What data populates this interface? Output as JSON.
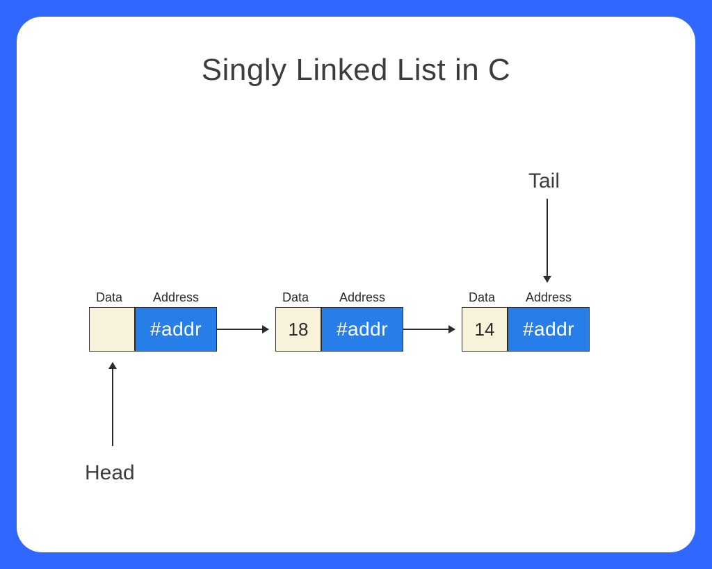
{
  "title": "Singly Linked List in C",
  "columns": {
    "data": "Data",
    "address": "Address"
  },
  "nodes": [
    {
      "data": "",
      "address": "#addr"
    },
    {
      "data": "18",
      "address": "#addr"
    },
    {
      "data": "14",
      "address": "#addr"
    }
  ],
  "markers": {
    "head": "Head",
    "tail": "Tail"
  }
}
